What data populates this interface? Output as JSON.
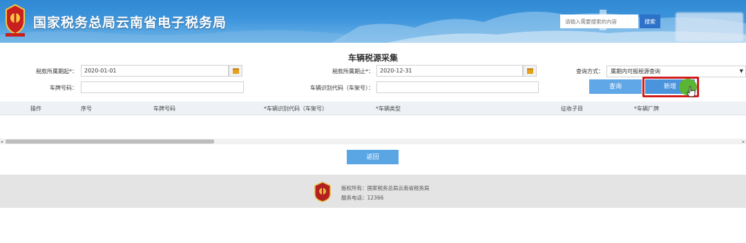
{
  "header": {
    "site_title": "国家税务总局云南省电子税务局",
    "search_placeholder": "请输入需要搜索的内容",
    "search_button": "搜索"
  },
  "form": {
    "page_title": "车辆税源采集",
    "period_start_label": "税款所属期起*：",
    "period_start_value": "2020-01-01",
    "period_end_label": "税款所属期止*：",
    "period_end_value": "2020-12-31",
    "query_mode_label": "查询方式：",
    "query_mode_value": "属期内可报税源查询",
    "plate_label": "车牌号码：",
    "vin_label": "车辆识别代码（车架号）："
  },
  "buttons": {
    "query": "查询",
    "add": "新增",
    "back": "返回"
  },
  "table": {
    "columns": [
      "操作",
      "序号",
      "车牌号码",
      "*车辆识别代码（车架号）",
      "*车辆类型",
      "征收子目",
      "*车辆厂牌"
    ]
  },
  "footer": {
    "copyright": "版权所有：国家税务总局云南省税务局",
    "phone": "服务电话：12366"
  },
  "colors": {
    "header_blue": "#3d95dc",
    "button_blue": "#5aa5e4",
    "highlight_red": "#d11b1b"
  }
}
